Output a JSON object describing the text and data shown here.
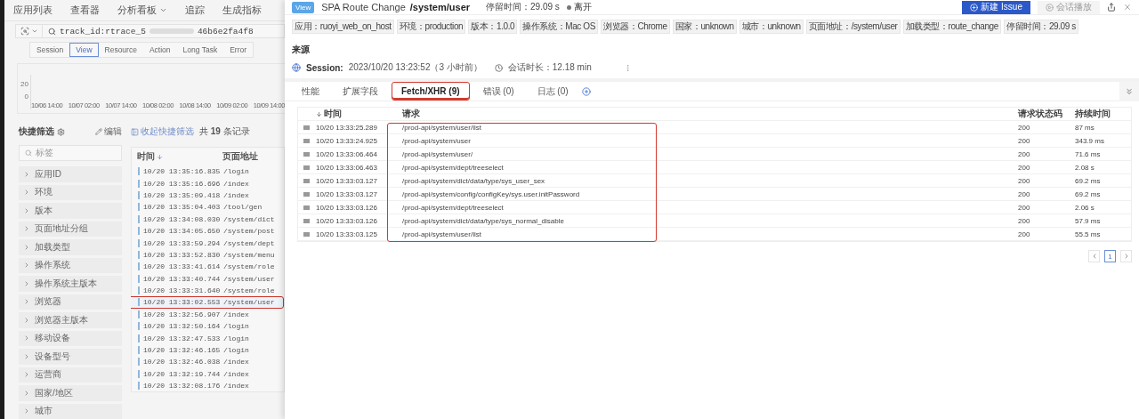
{
  "nav": {
    "items": [
      {
        "label": "应用列表",
        "dropdown": false
      },
      {
        "label": "查看器",
        "dropdown": false
      },
      {
        "label": "分析看板",
        "dropdown": true
      },
      {
        "label": "追踪",
        "dropdown": false
      },
      {
        "label": "生成指标",
        "dropdown": false
      }
    ]
  },
  "search": {
    "value_start": "track_id:rtrace_5",
    "value_end": "46b6e2fa4f8"
  },
  "event_types": [
    {
      "label": "Session",
      "selected": false
    },
    {
      "label": "View",
      "selected": true
    },
    {
      "label": "Resource",
      "selected": false
    },
    {
      "label": "Action",
      "selected": false
    },
    {
      "label": "Long Task",
      "selected": false
    },
    {
      "label": "Error",
      "selected": false
    }
  ],
  "chart": {
    "y_ticks": [
      "20",
      "0"
    ],
    "x_ticks": [
      "10/06 14:00",
      "10/07 02:00",
      "10/07 14:00",
      "10/08 02:00",
      "10/08 14:00",
      "10/09 02:00",
      "10/09 14:00"
    ]
  },
  "quick_filter": {
    "title": "快捷筛选",
    "edit": "编辑",
    "search_placeholder": "标签",
    "items": [
      "应用ID",
      "环境",
      "版本",
      "页面地址分组",
      "加载类型",
      "操作系统",
      "操作系统主版本",
      "浏览器",
      "浏览器主版本",
      "移动设备",
      "设备型号",
      "运营商",
      "国家/地区",
      "城市"
    ]
  },
  "records": {
    "collapse": "收起快捷筛选",
    "count_prefix": "共",
    "count": "19",
    "count_suffix": "条记录",
    "columns": [
      "时间",
      "页面地址"
    ],
    "rows": [
      {
        "time": "10/20 13:35:16.835",
        "page": "/login",
        "selected": false
      },
      {
        "time": "10/20 13:35:16.696",
        "page": "/index",
        "selected": false
      },
      {
        "time": "10/20 13:35:09.418",
        "page": "/index",
        "selected": false
      },
      {
        "time": "10/20 13:35:04.403",
        "page": "/tool/gen",
        "selected": false
      },
      {
        "time": "10/20 13:34:08.030",
        "page": "/system/dict",
        "selected": false
      },
      {
        "time": "10/20 13:34:05.650",
        "page": "/system/post",
        "selected": false
      },
      {
        "time": "10/20 13:33:59.294",
        "page": "/system/dept",
        "selected": false
      },
      {
        "time": "10/20 13:33:52.830",
        "page": "/system/menu",
        "selected": false
      },
      {
        "time": "10/20 13:33:41.614",
        "page": "/system/role",
        "selected": false
      },
      {
        "time": "10/20 13:33:40.744",
        "page": "/system/user",
        "selected": false
      },
      {
        "time": "10/20 13:33:31.640",
        "page": "/system/role",
        "selected": false
      },
      {
        "time": "10/20 13:33:02.553",
        "page": "/system/user",
        "selected": true
      },
      {
        "time": "10/20 13:32:56.907",
        "page": "/index",
        "selected": false
      },
      {
        "time": "10/20 13:32:50.164",
        "page": "/login",
        "selected": false
      },
      {
        "time": "10/20 13:32:47.533",
        "page": "/login",
        "selected": false
      },
      {
        "time": "10/20 13:32:46.165",
        "page": "/login",
        "selected": false
      },
      {
        "time": "10/20 13:32:46.038",
        "page": "/index",
        "selected": false
      },
      {
        "time": "10/20 13:32:19.744",
        "page": "/index",
        "selected": false
      },
      {
        "time": "10/20 13:32:08.176",
        "page": "/index",
        "selected": false
      }
    ]
  },
  "drawer": {
    "badge": "View",
    "title": "SPA Route Change",
    "path": "/system/user",
    "stay": "停留时间：29.09 s",
    "status": "离开",
    "new_issue": "新建 Issue",
    "replay": "会话播放",
    "replay_disabled": true,
    "tags": [
      "应用：ruoyi_web_on_host",
      "环境：production",
      "版本：1.0.0",
      "操作系统：Mac OS",
      "浏览器：Chrome",
      "国家：unknown",
      "城市：unknown",
      "页面地址：/system/user",
      "加载类型：route_change",
      "停留时间：29.09 s"
    ],
    "source_title": "来源",
    "session_label": "Session:",
    "session_time": "2023/10/20 13:23:52（3 小时前）",
    "session_duration": "会话时长：12.18 min",
    "tabs": [
      {
        "label": "性能",
        "selected": false,
        "highlighted": false
      },
      {
        "label": "扩展字段",
        "selected": false,
        "highlighted": false
      },
      {
        "label": "Fetch/XHR (9)",
        "selected": true,
        "highlighted": true
      },
      {
        "label": "错误 (0)",
        "selected": false,
        "highlighted": false
      },
      {
        "label": "日志 (0)",
        "selected": false,
        "highlighted": false
      }
    ],
    "table": {
      "columns": [
        "时间",
        "请求",
        "请求状态码",
        "持续时间"
      ],
      "request_column_highlighted": true,
      "rows": [
        {
          "time": "10/20 13:33:25.289",
          "request": "/prod-api/system/user/list",
          "status": "200",
          "duration": "87 ms"
        },
        {
          "time": "10/20 13:33:24.925",
          "request": "/prod-api/system/user",
          "status": "200",
          "duration": "343.9 ms"
        },
        {
          "time": "10/20 13:33:06.464",
          "request": "/prod-api/system/user/",
          "status": "200",
          "duration": "71.6 ms"
        },
        {
          "time": "10/20 13:33:06.463",
          "request": "/prod-api/system/dept/treeselect",
          "status": "200",
          "duration": "2.08 s"
        },
        {
          "time": "10/20 13:33:03.127",
          "request": "/prod-api/system/dict/data/type/sys_user_sex",
          "status": "200",
          "duration": "69.2 ms"
        },
        {
          "time": "10/20 13:33:03.127",
          "request": "/prod-api/system/config/configKey/sys.user.initPassword",
          "status": "200",
          "duration": "69.2 ms"
        },
        {
          "time": "10/20 13:33:03.126",
          "request": "/prod-api/system/dept/treeselect",
          "status": "200",
          "duration": "2.06 s"
        },
        {
          "time": "10/20 13:33:03.126",
          "request": "/prod-api/system/dict/data/type/sys_normal_disable",
          "status": "200",
          "duration": "57.9 ms"
        },
        {
          "time": "10/20 13:33:03.125",
          "request": "/prod-api/system/user/list",
          "status": "200",
          "duration": "55.5 ms"
        }
      ]
    },
    "pagination": {
      "pages": [
        {
          "label": "1",
          "selected": true
        }
      ]
    }
  }
}
